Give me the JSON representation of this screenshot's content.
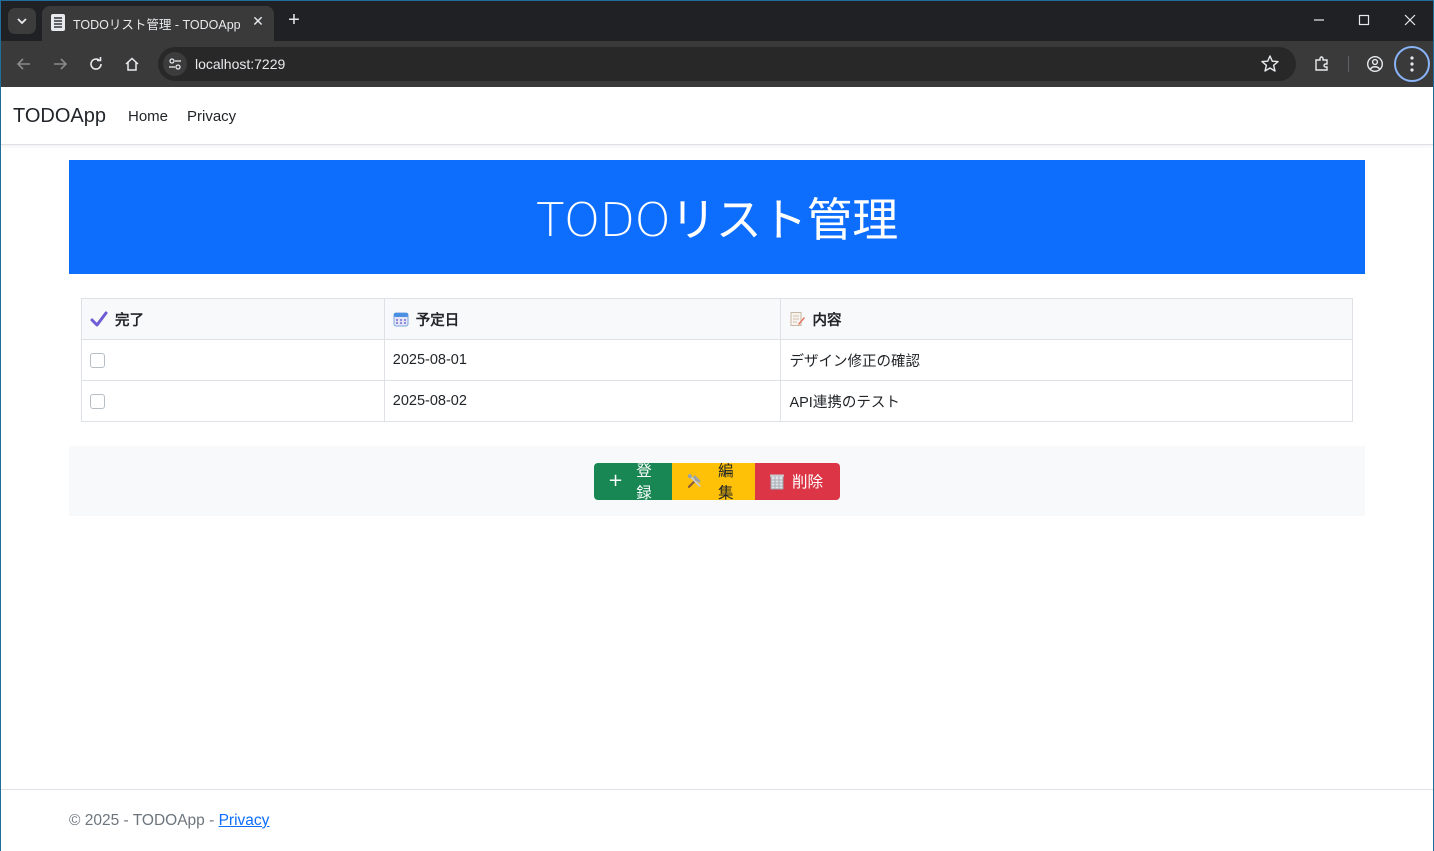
{
  "browser": {
    "tab_title": "TODOリスト管理 - TODOApp",
    "url": "localhost:7229",
    "new_tab_symbol": "+",
    "close_symbol": "✕"
  },
  "navbar": {
    "brand": "TODOApp",
    "links": [
      "Home",
      "Privacy"
    ]
  },
  "hero": {
    "title": "TODOリスト管理"
  },
  "table": {
    "columns": [
      {
        "label": "完了",
        "icon": "checkmark-icon"
      },
      {
        "label": "予定日",
        "icon": "calendar-icon"
      },
      {
        "label": "内容",
        "icon": "memo-icon"
      }
    ],
    "rows": [
      {
        "done": false,
        "date": "2025-08-01",
        "content": "デザイン修正の確認"
      },
      {
        "done": false,
        "date": "2025-08-02",
        "content": "API連携のテスト"
      }
    ]
  },
  "actions": {
    "add": "登録",
    "add_symbol": "+",
    "edit": "編集",
    "delete": "削除"
  },
  "footer": {
    "text": "© 2025 - TODOApp - ",
    "link": "Privacy"
  },
  "colors": {
    "primary": "#0d6efd",
    "success": "#198754",
    "warning": "#ffc107",
    "danger": "#dc3545"
  }
}
